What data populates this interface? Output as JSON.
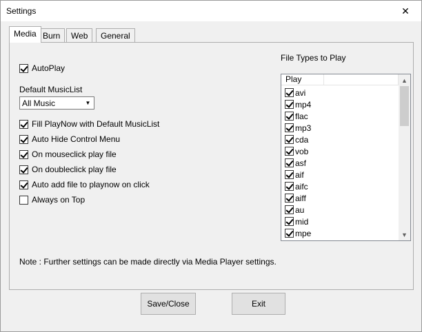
{
  "window": {
    "title": "Settings",
    "close_glyph": "✕"
  },
  "tabs": [
    {
      "label": "Media"
    },
    {
      "label": "Burn"
    },
    {
      "label": "Web"
    },
    {
      "label": "General"
    }
  ],
  "media": {
    "autoplay_label": "AutoPlay",
    "default_musiclist_label": "Default MusicList",
    "musiclist_value": "All Music",
    "options": [
      {
        "label": "Fill PlayNow with Default MusicList",
        "checked": true
      },
      {
        "label": "Auto Hide Control Menu",
        "checked": true
      },
      {
        "label": "On mouseclick play file",
        "checked": true
      },
      {
        "label": "On doubleclick play file",
        "checked": true
      },
      {
        "label": "Auto add file to playnow on click",
        "checked": true
      },
      {
        "label": "Always on Top",
        "checked": false
      }
    ],
    "note": "Note : Further settings can be made directly via Media Player settings."
  },
  "filetypes": {
    "heading": "File Types to Play",
    "column": "Play",
    "items": [
      {
        "label": "avi",
        "checked": true
      },
      {
        "label": "mp4",
        "checked": true
      },
      {
        "label": "flac",
        "checked": true
      },
      {
        "label": "mp3",
        "checked": true
      },
      {
        "label": "cda",
        "checked": true
      },
      {
        "label": "vob",
        "checked": true
      },
      {
        "label": "asf",
        "checked": true
      },
      {
        "label": "aif",
        "checked": true
      },
      {
        "label": "aifc",
        "checked": true
      },
      {
        "label": "aiff",
        "checked": true
      },
      {
        "label": "au",
        "checked": true
      },
      {
        "label": "mid",
        "checked": true
      },
      {
        "label": "mpe",
        "checked": true
      }
    ]
  },
  "buttons": {
    "save_close": "Save/Close",
    "exit": "Exit"
  }
}
